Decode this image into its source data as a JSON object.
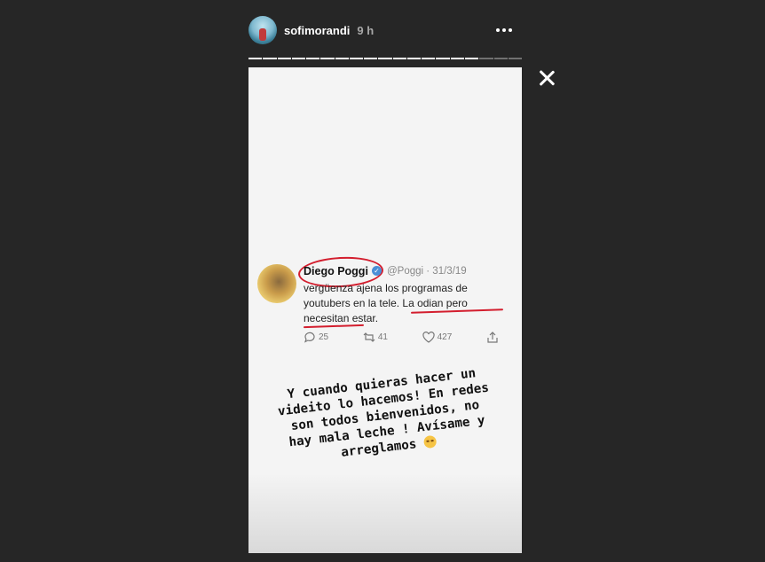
{
  "header": {
    "username": "sofimorandi",
    "time": "9 h"
  },
  "progress": {
    "total_segments": 19,
    "completed_segments": 16
  },
  "tweet": {
    "name": "Diego Poggi",
    "handle": "@Poggi · 31/3/19",
    "text_lines": [
      "vergüenza ajena los programas de",
      "youtubers en la tele. La odian pero",
      "necesitan estar."
    ],
    "replies": "25",
    "retweets": "41",
    "likes": "427"
  },
  "caption_lines": [
    "Y cuando quieras hacer un",
    "videito lo hacemos! En redes",
    "son todos bienvenidos, no",
    "hay mala leche ! Avísame y",
    "arreglamos"
  ],
  "colors": {
    "background": "#262626",
    "annotation_red": "#d31e2e"
  }
}
